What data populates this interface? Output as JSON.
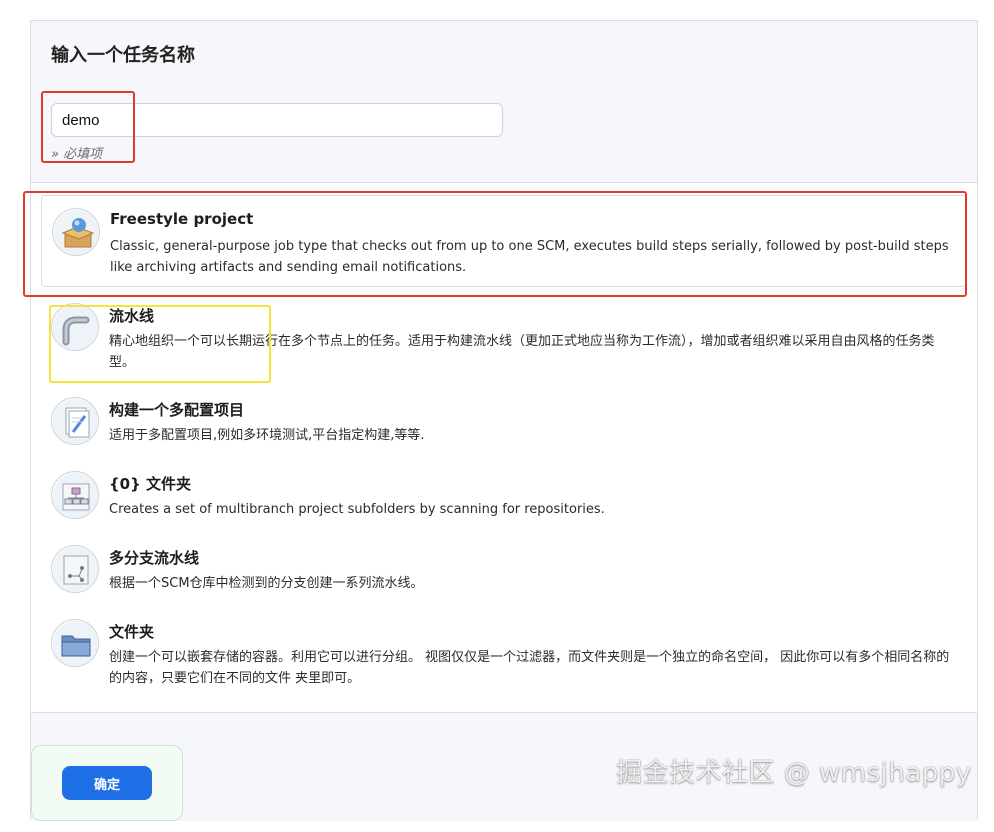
{
  "page": {
    "title": "输入一个任务名称"
  },
  "name_field": {
    "value": "demo",
    "required_note": "» 必填项"
  },
  "job_types": [
    {
      "name": "Freestyle project",
      "description": "Classic, general-purpose job type that checks out from up to one SCM, executes build steps serially, followed by post-build steps like archiving artifacts and sending email notifications.",
      "icon": "freestyle-project-icon",
      "selected": true
    },
    {
      "name": "流水线",
      "description": "精心地组织一个可以长期运行在多个节点上的任务。适用于构建流水线（更加正式地应当称为工作流），增加或者组织难以采用自由风格的任务类型。",
      "icon": "pipeline-icon",
      "selected": false
    },
    {
      "name": "构建一个多配置项目",
      "description": "适用于多配置项目,例如多环境测试,平台指定构建,等等.",
      "icon": "multi-config-icon",
      "selected": false
    },
    {
      "name": "{0} 文件夹",
      "description": "Creates a set of multibranch project subfolders by scanning for repositories.",
      "icon": "org-folder-icon",
      "selected": false
    },
    {
      "name": "多分支流水线",
      "description": "根据一个SCM仓库中检测到的分支创建一系列流水线。",
      "icon": "multibranch-pipeline-icon",
      "selected": false
    },
    {
      "name": "文件夹",
      "description": "创建一个可以嵌套存储的容器。利用它可以进行分组。 视图仅仅是一个过滤器，而文件夹则是一个独立的命名空间， 因此你可以有多个相同名称的的内容，只要它们在不同的文件 夹里即可。",
      "icon": "folder-icon",
      "selected": false
    }
  ],
  "footer": {
    "ok_label": "确定"
  },
  "watermark": "掘金技术社区 @ wmsjhappy",
  "colors": {
    "primary_button": "#1f6fe6",
    "annotation_red": "#e03b2c",
    "annotation_yellow": "#f6e33b"
  }
}
